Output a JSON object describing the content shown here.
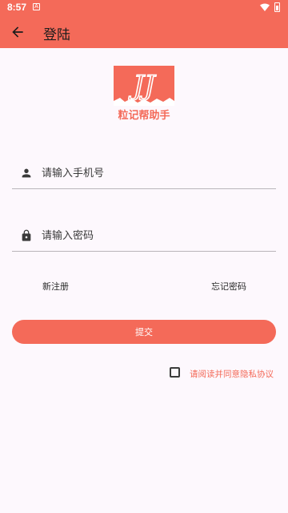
{
  "status_bar": {
    "time": "8:57",
    "notification_glyph": "A",
    "icons": [
      "wifi-icon",
      "battery-icon"
    ]
  },
  "app_bar": {
    "title": "登陆",
    "back_icon": "arrow-left-icon"
  },
  "logo": {
    "letters": "JJ",
    "brand_text": "粒记帮助手"
  },
  "form": {
    "phone_placeholder": "请输入手机号",
    "phone_icon": "person-icon",
    "password_placeholder": "请输入密码",
    "password_icon": "lock-icon"
  },
  "links": {
    "register": "新注册",
    "forgot_password": "忘记密码"
  },
  "submit_label": "提交",
  "agreement": {
    "checked": false,
    "text": "请阅读并同意隐私协议"
  },
  "colors": {
    "accent": "#f46a59",
    "background": "#fdf8fd",
    "divider": "#b9b5ba"
  }
}
